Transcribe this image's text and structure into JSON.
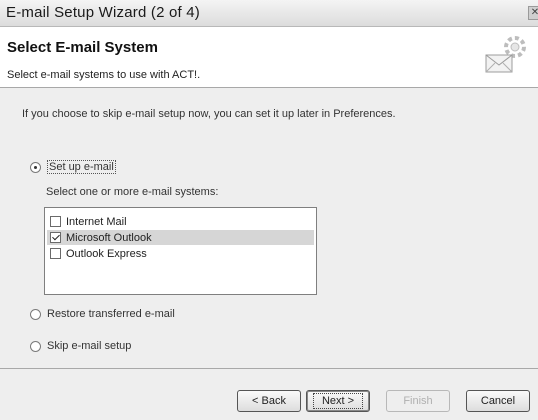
{
  "window": {
    "title": "E-mail Setup Wizard (2 of 4)"
  },
  "header": {
    "title": "Select E-mail System",
    "subtitle": "Select e-mail systems to use with ACT!.",
    "icon": "wizard-email-icon"
  },
  "content": {
    "intro": "If you choose to skip e-mail setup now, you can set it up later in Preferences.",
    "options": [
      {
        "label": "Set up e-mail",
        "checked": true
      },
      {
        "label": "Restore transferred e-mail",
        "checked": false
      },
      {
        "label": "Skip e-mail setup",
        "checked": false
      }
    ],
    "select_label": "Select one or more e-mail systems:",
    "email_systems": [
      {
        "label": "Internet Mail",
        "checked": false,
        "selected": false
      },
      {
        "label": "Microsoft Outlook",
        "checked": true,
        "selected": true
      },
      {
        "label": "Outlook Express",
        "checked": false,
        "selected": false
      }
    ]
  },
  "buttons": {
    "back": "< Back",
    "next": "Next >",
    "finish": "Finish",
    "cancel": "Cancel"
  }
}
